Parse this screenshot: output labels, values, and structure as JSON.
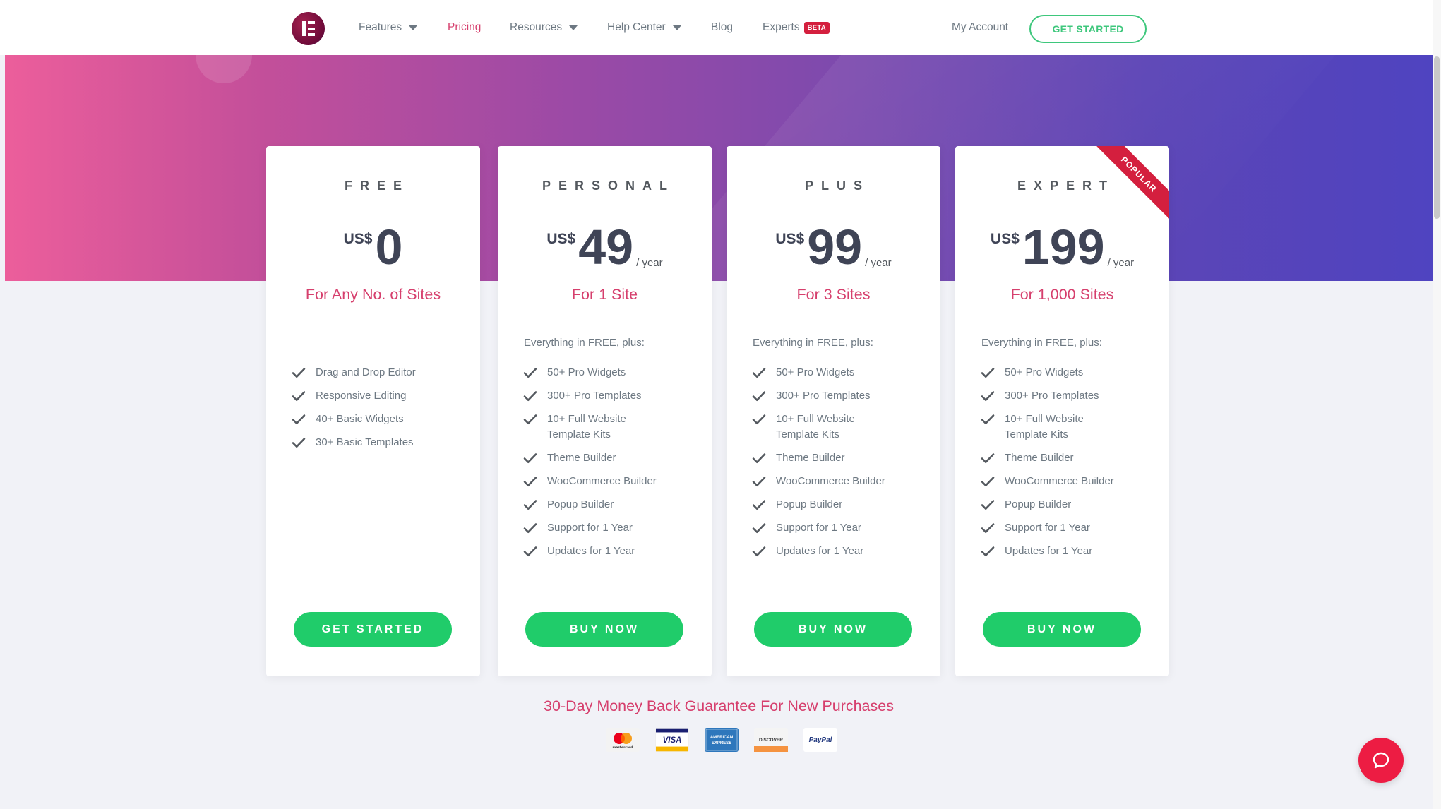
{
  "nav": {
    "features": "Features",
    "pricing": "Pricing",
    "resources": "Resources",
    "help_center": "Help Center",
    "blog": "Blog",
    "experts": "Experts",
    "beta_badge": "BETA",
    "my_account": "My Account",
    "get_started": "GET STARTED"
  },
  "colors": {
    "accent_pink": "#d63f6d",
    "cta_green": "#20cc6a",
    "ribbon_red": "#d41f3e"
  },
  "plans": [
    {
      "tier": "FREE",
      "currency": "US$",
      "amount": "0",
      "period": "",
      "sites": "For Any No. of Sites",
      "intro": "",
      "features": [
        "Drag and Drop Editor",
        "Responsive Editing",
        "40+ Basic Widgets",
        "30+ Basic Templates"
      ],
      "button": "GET STARTED"
    },
    {
      "tier": "PERSONAL",
      "currency": "US$",
      "amount": "49",
      "period": "/ year",
      "sites": "For 1 Site",
      "intro": "Everything in FREE, plus:",
      "features": [
        "50+ Pro Widgets",
        "300+ Pro Templates",
        "10+ Full Website\nTemplate Kits",
        "Theme Builder",
        "WooCommerce Builder",
        "Popup Builder",
        "Support for 1 Year",
        "Updates for 1 Year"
      ],
      "button": "BUY NOW"
    },
    {
      "tier": "PLUS",
      "currency": "US$",
      "amount": "99",
      "period": "/ year",
      "sites": "For 3 Sites",
      "intro": "Everything in FREE, plus:",
      "features": [
        "50+ Pro Widgets",
        "300+ Pro Templates",
        "10+ Full Website\nTemplate Kits",
        "Theme Builder",
        "WooCommerce Builder",
        "Popup Builder",
        "Support for 1 Year",
        "Updates for 1 Year"
      ],
      "button": "BUY NOW"
    },
    {
      "tier": "EXPERT",
      "currency": "US$",
      "amount": "199",
      "period": "/ year",
      "sites": "For 1,000 Sites",
      "intro": "Everything in FREE, plus:",
      "features": [
        "50+ Pro Widgets",
        "300+ Pro Templates",
        "10+ Full Website\nTemplate Kits",
        "Theme Builder",
        "WooCommerce Builder",
        "Popup Builder",
        "Support for 1 Year",
        "Updates for 1 Year"
      ],
      "button": "BUY NOW",
      "ribbon": "POPULAR"
    }
  ],
  "guarantee": "30-Day Money Back Guarantee For New Purchases",
  "payments": [
    {
      "name": "mastercard-icon",
      "label": "mastercard"
    },
    {
      "name": "visa-icon",
      "label": "VISA"
    },
    {
      "name": "american-express-icon",
      "label": "AMERICAN EXPRESS"
    },
    {
      "name": "discover-icon",
      "label": "DISCOVER"
    },
    {
      "name": "paypal-icon",
      "label": "PayPal"
    }
  ]
}
